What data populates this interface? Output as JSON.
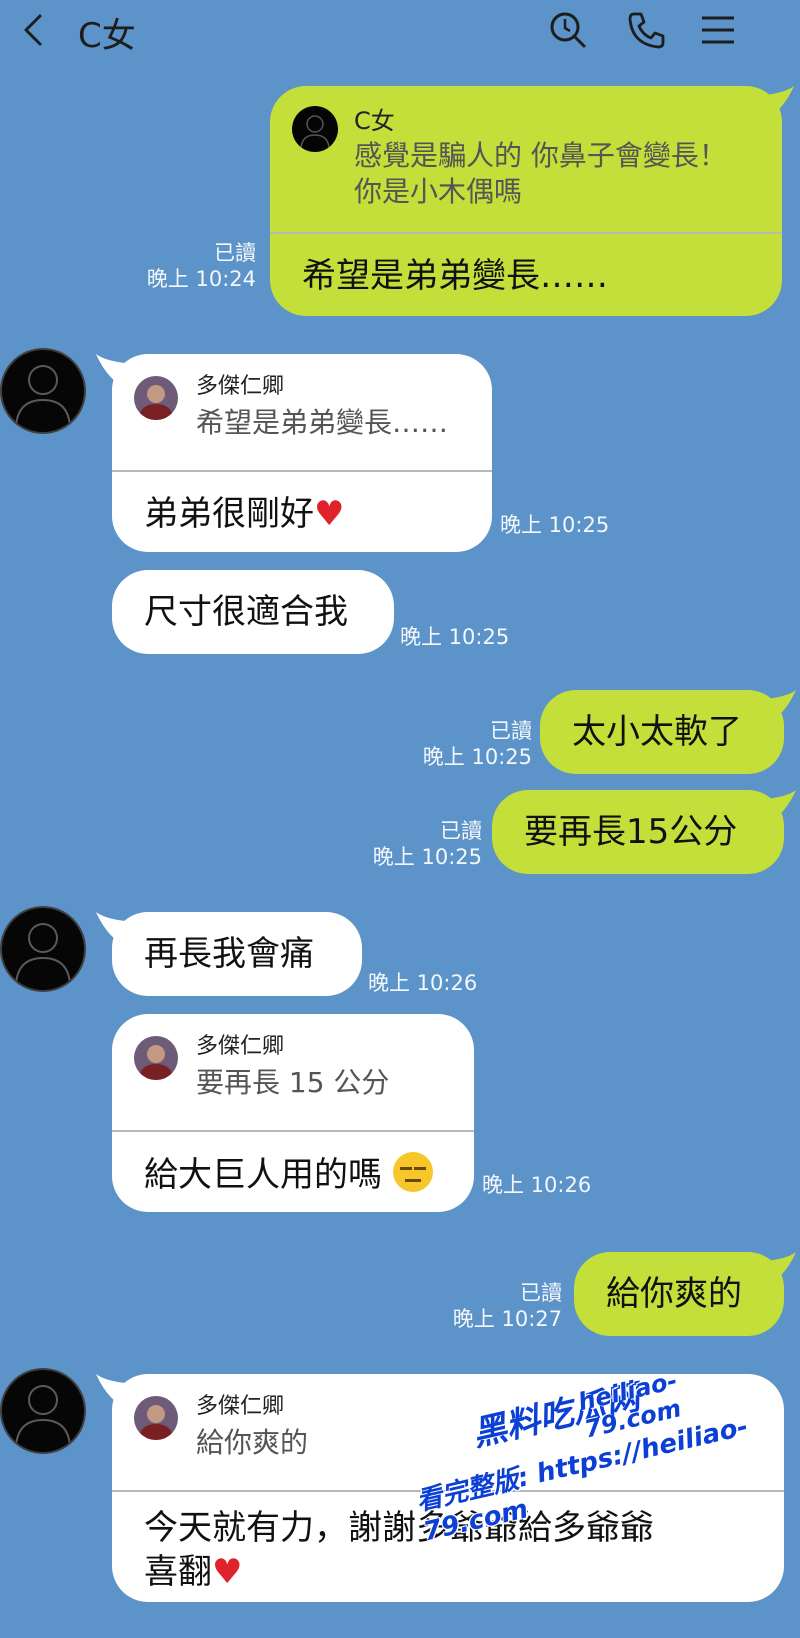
{
  "header": {
    "title": "C女",
    "icons": [
      "back-icon",
      "search-icon",
      "phone-icon",
      "menu-icon"
    ]
  },
  "colors": {
    "background": "#5c93c9",
    "outgoing_bubble": "#c4de3a",
    "incoming_bubble": "#ffffff",
    "heart": "#e0222a"
  },
  "messages": [
    {
      "side": "out",
      "quote": {
        "name": "C女",
        "text_line1": "感覺是騙人的 你鼻子會變長！",
        "text_line2": "你是小木偶嗎"
      },
      "text": "希望是弟弟變長……",
      "read": "已讀",
      "time": "晚上 10:24"
    },
    {
      "side": "in",
      "quote": {
        "name": "多傑仁卿",
        "text": "希望是弟弟變長……"
      },
      "text": "弟弟很剛好",
      "emoji": "heart",
      "time": "晚上 10:25"
    },
    {
      "side": "in",
      "text": "尺寸很適合我",
      "time": "晚上 10:25"
    },
    {
      "side": "out",
      "text": "太小太軟了",
      "read": "已讀",
      "time": "晚上 10:25"
    },
    {
      "side": "out",
      "text": "要再長15公分",
      "read": "已讀",
      "time": "晚上 10:25"
    },
    {
      "side": "in",
      "text": "再長我會痛",
      "time": "晚上 10:26"
    },
    {
      "side": "in",
      "quote": {
        "name": "多傑仁卿",
        "text": "要再長 15 公分"
      },
      "text": "給大巨人用的嗎",
      "emoji": "expressionless-face",
      "time": "晚上 10:26"
    },
    {
      "side": "out",
      "text": "給你爽的",
      "read": "已讀",
      "time": "晚上 10:27"
    },
    {
      "side": "in",
      "quote": {
        "name": "多傑仁卿",
        "text": "給你爽的"
      },
      "text_line1": "今天就有力，謝謝多爺爺給多爺爺",
      "text_line2": "喜翻",
      "emoji": "heart"
    }
  ],
  "watermark": {
    "brand": "黑料吃瓜网",
    "url": "heiliao-79.com",
    "line": "看完整版: https://heiliao-79.com"
  }
}
